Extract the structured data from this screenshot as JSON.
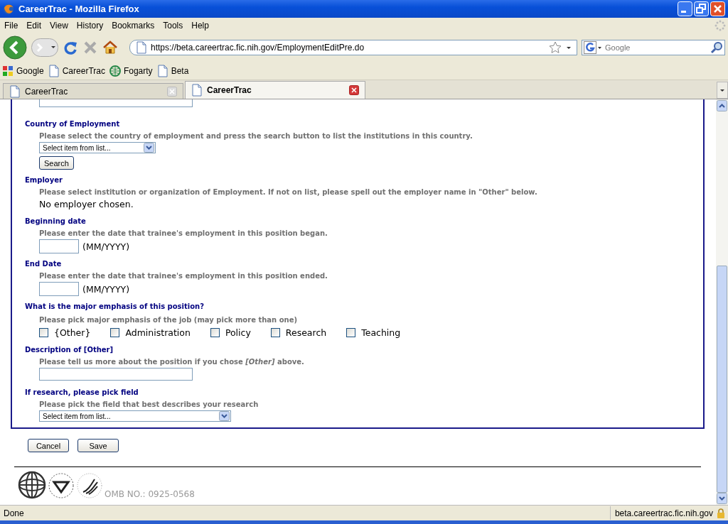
{
  "window": {
    "title": "CareerTrac - Mozilla Firefox"
  },
  "menu": [
    "File",
    "Edit",
    "View",
    "History",
    "Bookmarks",
    "Tools",
    "Help"
  ],
  "toolbar": {
    "url": "https://beta.careertrac.fic.nih.gov/EmploymentEditPre.do",
    "search_placeholder": "Google"
  },
  "bookmarks": [
    {
      "label": "Google",
      "kind": "google"
    },
    {
      "label": "CareerTrac",
      "kind": "page"
    },
    {
      "label": "Fogarty",
      "kind": "fogarty"
    },
    {
      "label": "Beta",
      "kind": "page"
    }
  ],
  "tabs": [
    {
      "label": "CareerTrac",
      "selected": false
    },
    {
      "label": "CareerTrac",
      "selected": true
    }
  ],
  "form": [
    {
      "kind": "cut_field"
    },
    {
      "kind": "select_search",
      "heading": "Country of Employment",
      "help": "Please select the country of employment and press the search button to list the institutions in this country.",
      "select": "Select item from list...",
      "button": "Search"
    },
    {
      "kind": "note",
      "heading": "Employer",
      "help": "Please select institution or organization of Employment. If not on list, please spell out the employer name in \"Other\" below.",
      "note": "No employer chosen."
    },
    {
      "kind": "date",
      "heading": "Beginning date",
      "help": "Please enter the date that trainee's employment in this position began.",
      "suffix": "(MM/YYYY)"
    },
    {
      "kind": "date",
      "heading": "End Date",
      "help": "Please enter the date that trainee's employment in this position ended.",
      "suffix": "(MM/YYYY)"
    },
    {
      "kind": "checkboxes",
      "heading": "What is the major emphasis of this position?",
      "help": "Please pick major emphasis of the job (may pick more than one)",
      "options": [
        {
          "label": "{Other}",
          "checked": false
        },
        {
          "label": "Administration",
          "checked": false
        },
        {
          "label": "Policy",
          "checked": false
        },
        {
          "label": "Research",
          "checked": false
        },
        {
          "label": "Teaching",
          "checked": false
        }
      ]
    },
    {
      "kind": "text",
      "heading": "Description of [Other]",
      "help": "Please tell us more about the position if you chose *[Other]* above."
    },
    {
      "kind": "select",
      "heading": "If research, please pick field",
      "help": "Please pick the field that best describes your research",
      "select": "Select item from list..."
    }
  ],
  "buttons": [
    "Cancel",
    "Save"
  ],
  "footer": {
    "omb": "OMB NO.: 0925-0568"
  },
  "status_bar": {
    "text": "Done",
    "host": "beta.careertrac.fic.nih.gov"
  }
}
